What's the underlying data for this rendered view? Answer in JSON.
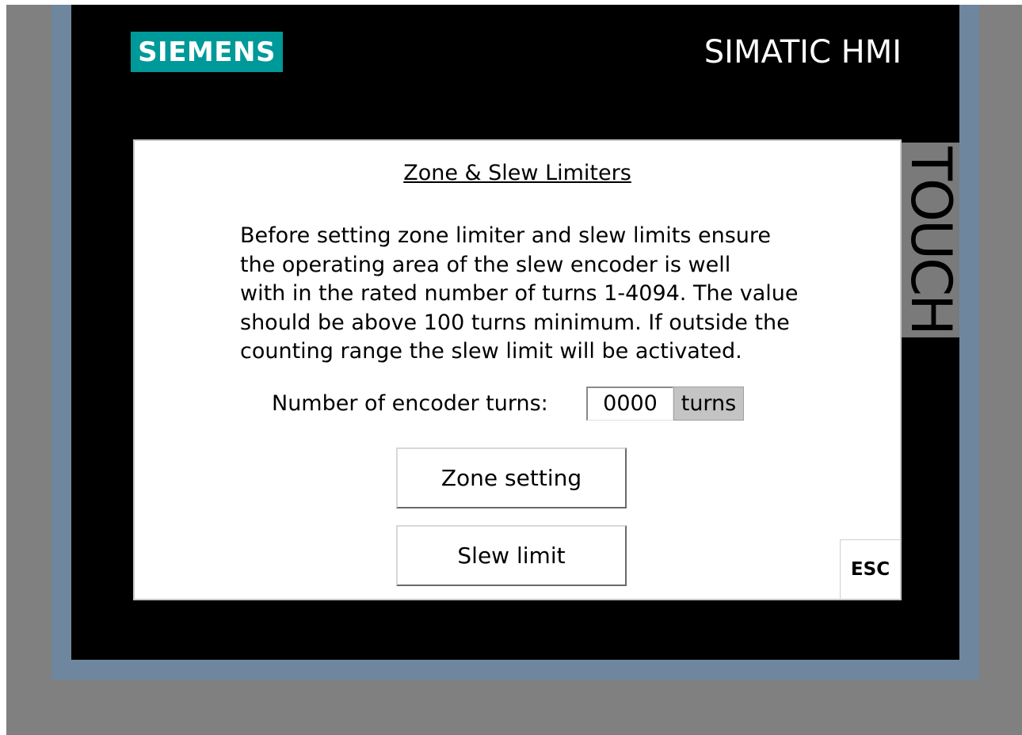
{
  "device": {
    "logo_text": "SIEMENS",
    "brand_label": "SIMATIC HMI",
    "touch_label": "TOUCH"
  },
  "screen": {
    "title": "Zone & Slew Limiters",
    "description_lines": [
      "Before setting zone limiter and slew limits ensure",
      "the operating area of the slew encoder is well",
      "with in the rated number of turns 1-4094. The value",
      "should be above 100 turns minimum. If outside the",
      "counting range the slew limit will be activated."
    ],
    "encoder": {
      "label": "Number of encoder turns:",
      "value": "0000",
      "unit": "turns"
    },
    "buttons": {
      "zone_setting": "Zone setting",
      "slew_limit": "Slew limit",
      "esc": "ESC"
    }
  },
  "colors": {
    "logo_bg": "#009999",
    "bezel": "#000000",
    "bezel_frame": "#6f879e",
    "background": "#808080",
    "unit_bg": "#c4c4c4"
  }
}
